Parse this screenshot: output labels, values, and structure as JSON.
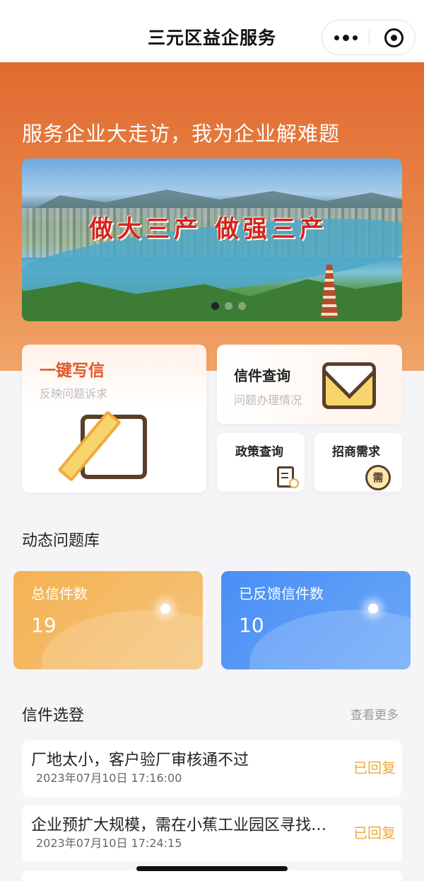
{
  "navbar": {
    "title": "三元区益企服务"
  },
  "hero": {
    "slogan": "服务企业大走访，我为企业解难题",
    "banner_caption": "做大三产  做强三产",
    "banner_active_index": 0,
    "banner_count": 3
  },
  "services": {
    "write": {
      "label": "一键写信",
      "sub": "反映问题诉求",
      "icon": "edit-icon"
    },
    "query": {
      "label": "信件查询",
      "sub": "问题办理情况",
      "icon": "envelope-icon"
    },
    "policy": {
      "label": "政策查询",
      "icon": "document-icon"
    },
    "invest": {
      "label": "招商需求",
      "icon": "need-icon",
      "icon_text": "需"
    }
  },
  "dynamic": {
    "title": "动态问题库",
    "total_label": "总信件数",
    "total_value": "19",
    "replied_label": "已反馈信件数",
    "replied_value": "10"
  },
  "published": {
    "title": "信件选登",
    "more": "查看更多",
    "items": [
      {
        "title": "厂地太小，客户验厂审核通不过",
        "date": "2023年07月10日 17:16:00",
        "status": "已回复"
      },
      {
        "title": "企业预扩大规模，需在小蕉工业园区寻找合适厂房",
        "date": "2023年07月10日 17:24:15",
        "status": "已回复"
      }
    ]
  },
  "colors": {
    "brand_orange": "#e06a30",
    "status_replied": "#f0a93c",
    "stat_orange": "#f5b253",
    "stat_blue": "#4a8ef5"
  }
}
